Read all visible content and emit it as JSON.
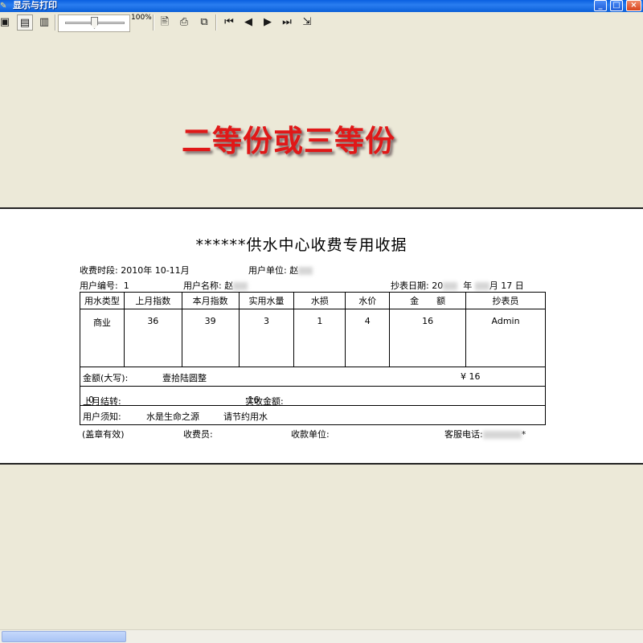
{
  "window": {
    "title": "显示与打印",
    "minimize": "_",
    "maximize": "□",
    "close": "×"
  },
  "toolbar": {
    "zoom_label": "100%",
    "icons": {
      "page_single": "▣",
      "page_fit": "▤",
      "page_width": "▥",
      "print_setup": "🖹",
      "print": "⎙",
      "print_copies": "⧉",
      "first": "⏮",
      "prev": "◀",
      "next": "▶",
      "last": "⏭",
      "export": "⇲"
    }
  },
  "overlay_text": "二等份或三等份",
  "receipt": {
    "title": "******供水中心收费专用收据",
    "charge_period_label": "收费时段:",
    "charge_period_value": "2010年 10-11月",
    "user_unit_label": "用户单位:",
    "user_unit_value": "赵",
    "user_no_label": "用户编号:",
    "user_no_value": "1",
    "user_name_label": "用户名称:",
    "user_name_value": "赵",
    "reading_date_label": "抄表日期:",
    "reading_date_value": "20",
    "reading_date_year": "年",
    "reading_date_rest": "月 17 日",
    "table": {
      "headers": [
        "用水类型",
        "上月指数",
        "本月指数",
        "实用水量",
        "水损",
        "水价",
        "金　　额",
        "抄表员"
      ],
      "row": [
        "商业",
        "36",
        "39",
        "3",
        "1",
        "4",
        "16",
        "Admin"
      ]
    },
    "amount_upper_label": "金额(大写):",
    "amount_upper_value": "壹拾陆圆整",
    "amount_value": "¥ 16",
    "last_balance_label": "上月结转:",
    "last_balance_value": "0",
    "received_label": "实收金额:",
    "received_value": "16",
    "notice_label": "用户须知:",
    "notice_1": "水是生命之源",
    "notice_2": "请节约用水",
    "footer_stamp": "(盖章有效)",
    "footer_cashier": "收费员:",
    "footer_unit": "收款单位:",
    "footer_phone": "客服电话:",
    "footer_phone_tail": "*"
  }
}
